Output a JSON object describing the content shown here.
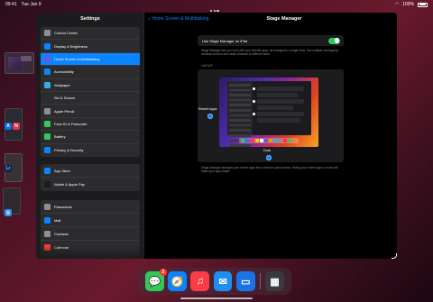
{
  "status": {
    "time": "09:41",
    "date": "Tue Jan 9",
    "battery": "100%",
    "battery_level": 1.0
  },
  "sidebar": {
    "title": "Settings",
    "group1": [
      {
        "label": "Control Center",
        "color": "#8e8e93"
      },
      {
        "label": "Display & Brightness",
        "color": "#0a84ff"
      },
      {
        "label": "Home Screen & Multitasking",
        "color": "#5e5ce6",
        "selected": true
      },
      {
        "label": "Accessibility",
        "color": "#0a84ff"
      },
      {
        "label": "Wallpaper",
        "color": "#32ade6"
      },
      {
        "label": "Siri & Search",
        "color": "#2c2c2e"
      },
      {
        "label": "Apple Pencil",
        "color": "#8e8e93"
      },
      {
        "label": "Face ID & Passcode",
        "color": "#34c759"
      },
      {
        "label": "Battery",
        "color": "#34c759"
      },
      {
        "label": "Privacy & Security",
        "color": "#0a84ff"
      }
    ],
    "group2": [
      {
        "label": "App Store",
        "color": "#0a84ff"
      },
      {
        "label": "Wallet & Apple Pay",
        "color": "#1c1c1e"
      }
    ],
    "group3": [
      {
        "label": "Passwords",
        "color": "#8e8e93"
      },
      {
        "label": "Mail",
        "color": "#0a84ff"
      },
      {
        "label": "Contacts",
        "color": "#8e8e93"
      },
      {
        "label": "Calendar",
        "color": "#ff3b30"
      }
    ]
  },
  "pane": {
    "back_label": "Home Screen & Multitasking",
    "title": "Stage Manager",
    "toggle_label": "Use Stage Manager on iPad",
    "toggle_on": true,
    "description1": "Stage Manager lets you work with your favorite apps, all arranged in a single view. Use multiple overlapping windows at once and rotate windows to different sizes.",
    "layout_label": "LAYOUT",
    "recent_apps_label": "Recent Apps",
    "dock_label": "Dock",
    "description2": "Stage Manager arranges your recent apps into a strip for quick access. Hiding your recent apps or dock will make your apps larger."
  },
  "dock": {
    "apps": [
      {
        "name": "Messages",
        "glyph": "💬",
        "color": "#34c759",
        "badge": "2"
      },
      {
        "name": "Safari",
        "glyph": "🧭",
        "color": "#0a84ff"
      },
      {
        "name": "Music",
        "glyph": "♫",
        "color": "#fc3c44"
      },
      {
        "name": "Mail",
        "glyph": "✉",
        "color": "#1f8ef1"
      },
      {
        "name": "Files",
        "glyph": "▭",
        "color": "#1a73e8"
      },
      {
        "name": "App Library",
        "glyph": "▦",
        "color": "#3a3a3c"
      }
    ]
  }
}
